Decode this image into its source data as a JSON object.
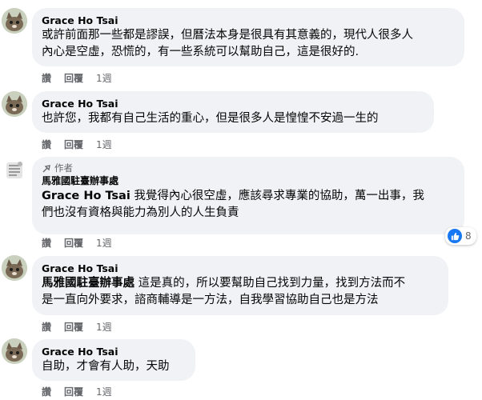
{
  "comments": [
    {
      "name": "Grace Ho Tsai",
      "text": "或許前面那一些都是謬誤，但曆法本身是很具有其意義的，現代人很多人內心是空虛，恐慌的，有一些系統可以幫助自己，這是很好的.",
      "line1": "或許前面那一些都是謬誤，但曆法本身是很具有其意義的，現代人很多人",
      "line2": "內心是空虛，恐慌的，有一些系統可以幫助自己，這是很好的.",
      "actions": {
        "like": "讚",
        "reply": "回覆",
        "time": "1週"
      }
    },
    {
      "name": "Grace Ho Tsai",
      "text": "也許您，我都有自己生活的重心，但是很多人是惶惶不安過一生的",
      "actions": {
        "like": "讚",
        "reply": "回覆",
        "time": "1週"
      }
    },
    {
      "author_badge": "作者",
      "name": "馬雅國駐臺辦事處",
      "mention": "Grace Ho Tsai",
      "line1": "我覺得內心很空虛，應該尋求專業的協助，萬一出事，我",
      "line2": "們也沒有資格與能力為別人的人生負責",
      "actions": {
        "like": "讚",
        "reply": "回覆",
        "time": "1週"
      },
      "reaction_count": "8"
    },
    {
      "name": "Grace Ho Tsai",
      "mention": "馬雅國駐臺辦事處",
      "line1": "這是真的，所以要幫助自己找到力量，找到方法而不",
      "line2": "是一直向外要求，諮商輔導是一方法，自我學習協助自己也是方法",
      "actions": {
        "like": "讚",
        "reply": "回覆",
        "time": "1週"
      }
    },
    {
      "name": "Grace Ho Tsai",
      "text": "自助，才會有人助，天助",
      "actions": {
        "like": "讚",
        "reply": "回覆",
        "time": "1週"
      }
    }
  ],
  "colors": {
    "bubble": "#f0f2f5",
    "meta": "#65676b",
    "like": "#1877f2"
  }
}
